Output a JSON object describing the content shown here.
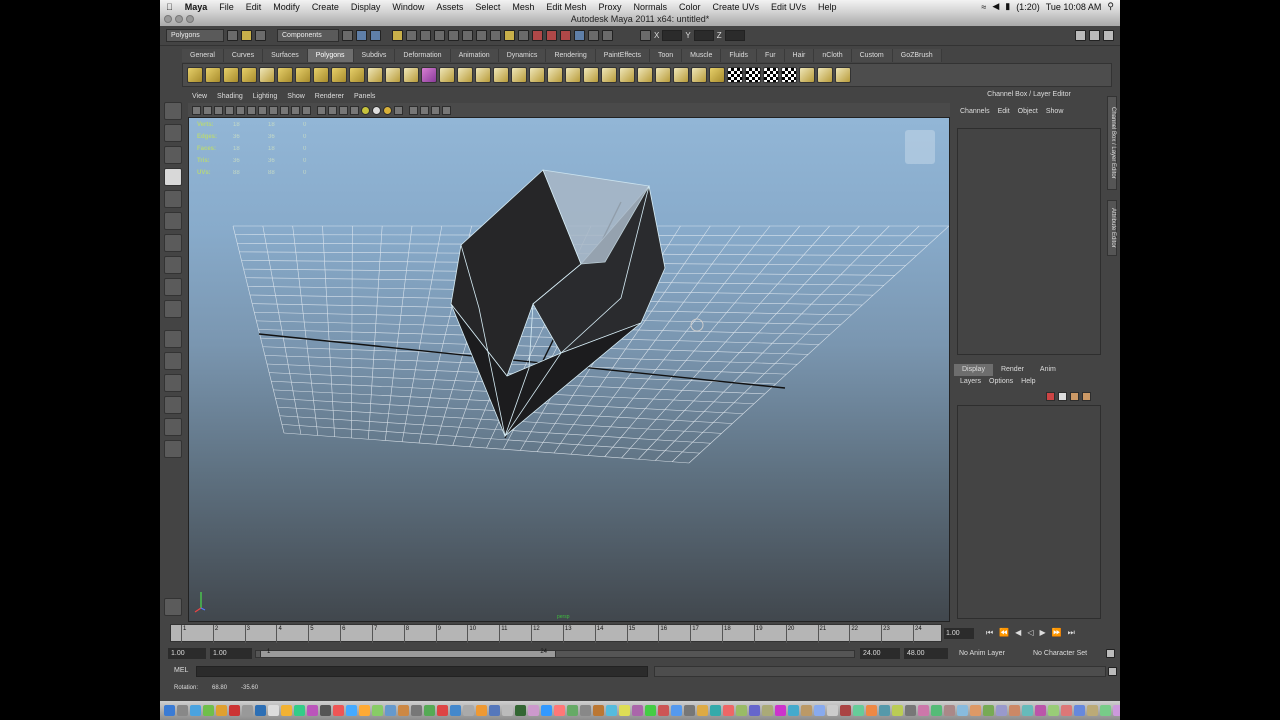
{
  "menubar": {
    "app": "Maya",
    "items": [
      "File",
      "Edit",
      "Modify",
      "Create",
      "Display",
      "Window",
      "Assets",
      "Select",
      "Mesh",
      "Edit Mesh",
      "Proxy",
      "Normals",
      "Color",
      "Create UVs",
      "Edit UVs",
      "Help"
    ],
    "battery": "(1:20)",
    "clock": "Tue 10:08 AM"
  },
  "window": {
    "title": "Autodesk Maya 2011 x64: untitled*"
  },
  "statusline": {
    "menuset": "Polygons",
    "selection_mode": "Components",
    "x_label": "X",
    "y_label": "Y",
    "z_label": "Z"
  },
  "shelf": {
    "tabs": [
      "General",
      "Curves",
      "Surfaces",
      "Polygons",
      "Subdivs",
      "Deformation",
      "Animation",
      "Dynamics",
      "Rendering",
      "PaintEffects",
      "Toon",
      "Muscle",
      "Fluids",
      "Fur",
      "Hair",
      "nCloth",
      "Custom",
      "GoZBrush"
    ],
    "active_tab": "Polygons"
  },
  "viewport": {
    "menu": [
      "View",
      "Shading",
      "Lighting",
      "Show",
      "Renderer",
      "Panels"
    ],
    "hud": [
      {
        "label": "Verts:",
        "v1": "18",
        "v2": "18",
        "v3": "0"
      },
      {
        "label": "Edges:",
        "v1": "36",
        "v2": "36",
        "v3": "0"
      },
      {
        "label": "Faces:",
        "v1": "18",
        "v2": "18",
        "v3": "0"
      },
      {
        "label": "Tris:",
        "v1": "36",
        "v2": "36",
        "v3": "0"
      },
      {
        "label": "UVs:",
        "v1": "88",
        "v2": "88",
        "v3": "0"
      }
    ],
    "camera_name": "persp"
  },
  "channelbox": {
    "title": "Channel Box / Layer Editor",
    "menu": [
      "Channels",
      "Edit",
      "Object",
      "Show"
    ],
    "side_tabs": [
      "Channel Box / Layer Editor",
      "Attribute Editor"
    ]
  },
  "layers": {
    "tabs": [
      "Display",
      "Render",
      "Anim"
    ],
    "active_tab": "Display",
    "menu": [
      "Layers",
      "Options",
      "Help"
    ]
  },
  "timeslider": {
    "ticks": [
      "1",
      "2",
      "3",
      "4",
      "5",
      "6",
      "7",
      "8",
      "9",
      "10",
      "11",
      "12",
      "13",
      "14",
      "15",
      "16",
      "17",
      "18",
      "19",
      "20",
      "21",
      "22",
      "23",
      "24"
    ],
    "current_frame": "1.00"
  },
  "range": {
    "start": "1.00",
    "anim_start": "1.00",
    "range_start": "1",
    "range_end": "24",
    "end": "24.00",
    "anim_end": "48.00",
    "anim_layer": "No Anim Layer",
    "char_set": "No Character Set"
  },
  "commandline": {
    "label": "MEL"
  },
  "helpline": {
    "label": "Rotation:",
    "x": "68.80",
    "y": "-35.60"
  },
  "colors": {
    "viewport_top": "#92b6d6",
    "viewport_bottom": "#41474d",
    "accent": "#c9b04a"
  }
}
